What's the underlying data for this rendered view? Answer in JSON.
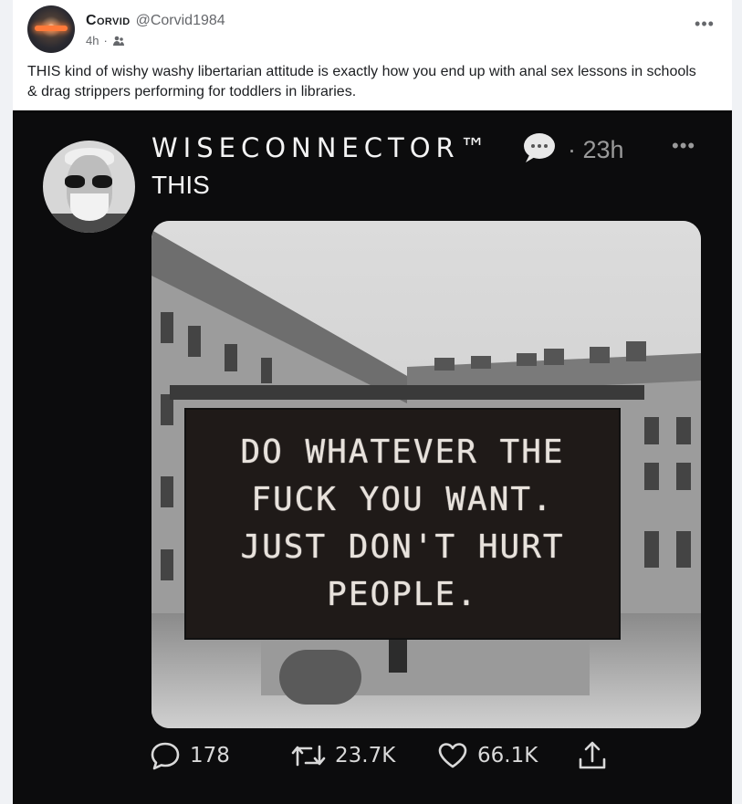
{
  "post": {
    "author_name": "Corvid",
    "author_handle": "@Corvid1984",
    "time": "4h",
    "separator": "·",
    "more_label": "•••",
    "text": "THIS kind of wishy washy libertarian attitude is exactly how you end up with anal sex lessons in schools & drag strippers performing for toddlers in libraries."
  },
  "embedded_tweet": {
    "author_name": "WISECONNECTOR™",
    "time": "· 23h",
    "more_label": "•••",
    "text": "THIS",
    "sign_lines": [
      "DO WHATEVER THE",
      "FUCK YOU WANT.",
      "JUST DON'T HURT",
      "PEOPLE."
    ],
    "actions": {
      "replies": "178",
      "retweets": "23.7K",
      "likes": "66.1K"
    }
  },
  "icons": {
    "audience": "friends-icon",
    "speech_bubble": "speech-bubble-icon",
    "reply": "reply-icon",
    "retweet": "retweet-icon",
    "like": "heart-icon",
    "share": "share-icon"
  }
}
